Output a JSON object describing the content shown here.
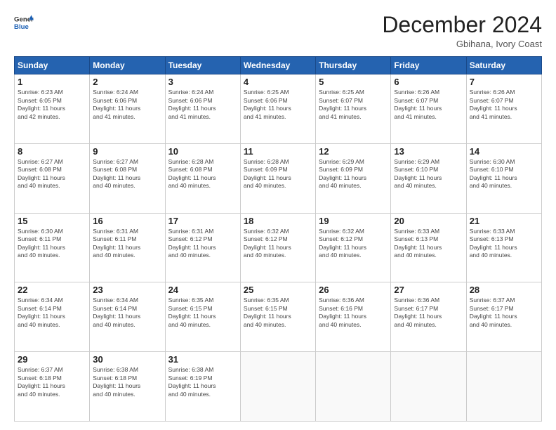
{
  "header": {
    "logo_line1": "General",
    "logo_line2": "Blue",
    "month_title": "December 2024",
    "location": "Gbihana, Ivory Coast"
  },
  "calendar": {
    "days_of_week": [
      "Sunday",
      "Monday",
      "Tuesday",
      "Wednesday",
      "Thursday",
      "Friday",
      "Saturday"
    ],
    "weeks": [
      [
        {
          "day": "1",
          "info": "Sunrise: 6:23 AM\nSunset: 6:05 PM\nDaylight: 11 hours\nand 42 minutes."
        },
        {
          "day": "2",
          "info": "Sunrise: 6:24 AM\nSunset: 6:06 PM\nDaylight: 11 hours\nand 41 minutes."
        },
        {
          "day": "3",
          "info": "Sunrise: 6:24 AM\nSunset: 6:06 PM\nDaylight: 11 hours\nand 41 minutes."
        },
        {
          "day": "4",
          "info": "Sunrise: 6:25 AM\nSunset: 6:06 PM\nDaylight: 11 hours\nand 41 minutes."
        },
        {
          "day": "5",
          "info": "Sunrise: 6:25 AM\nSunset: 6:07 PM\nDaylight: 11 hours\nand 41 minutes."
        },
        {
          "day": "6",
          "info": "Sunrise: 6:26 AM\nSunset: 6:07 PM\nDaylight: 11 hours\nand 41 minutes."
        },
        {
          "day": "7",
          "info": "Sunrise: 6:26 AM\nSunset: 6:07 PM\nDaylight: 11 hours\nand 41 minutes."
        }
      ],
      [
        {
          "day": "8",
          "info": "Sunrise: 6:27 AM\nSunset: 6:08 PM\nDaylight: 11 hours\nand 40 minutes."
        },
        {
          "day": "9",
          "info": "Sunrise: 6:27 AM\nSunset: 6:08 PM\nDaylight: 11 hours\nand 40 minutes."
        },
        {
          "day": "10",
          "info": "Sunrise: 6:28 AM\nSunset: 6:08 PM\nDaylight: 11 hours\nand 40 minutes."
        },
        {
          "day": "11",
          "info": "Sunrise: 6:28 AM\nSunset: 6:09 PM\nDaylight: 11 hours\nand 40 minutes."
        },
        {
          "day": "12",
          "info": "Sunrise: 6:29 AM\nSunset: 6:09 PM\nDaylight: 11 hours\nand 40 minutes."
        },
        {
          "day": "13",
          "info": "Sunrise: 6:29 AM\nSunset: 6:10 PM\nDaylight: 11 hours\nand 40 minutes."
        },
        {
          "day": "14",
          "info": "Sunrise: 6:30 AM\nSunset: 6:10 PM\nDaylight: 11 hours\nand 40 minutes."
        }
      ],
      [
        {
          "day": "15",
          "info": "Sunrise: 6:30 AM\nSunset: 6:11 PM\nDaylight: 11 hours\nand 40 minutes."
        },
        {
          "day": "16",
          "info": "Sunrise: 6:31 AM\nSunset: 6:11 PM\nDaylight: 11 hours\nand 40 minutes."
        },
        {
          "day": "17",
          "info": "Sunrise: 6:31 AM\nSunset: 6:12 PM\nDaylight: 11 hours\nand 40 minutes."
        },
        {
          "day": "18",
          "info": "Sunrise: 6:32 AM\nSunset: 6:12 PM\nDaylight: 11 hours\nand 40 minutes."
        },
        {
          "day": "19",
          "info": "Sunrise: 6:32 AM\nSunset: 6:12 PM\nDaylight: 11 hours\nand 40 minutes."
        },
        {
          "day": "20",
          "info": "Sunrise: 6:33 AM\nSunset: 6:13 PM\nDaylight: 11 hours\nand 40 minutes."
        },
        {
          "day": "21",
          "info": "Sunrise: 6:33 AM\nSunset: 6:13 PM\nDaylight: 11 hours\nand 40 minutes."
        }
      ],
      [
        {
          "day": "22",
          "info": "Sunrise: 6:34 AM\nSunset: 6:14 PM\nDaylight: 11 hours\nand 40 minutes."
        },
        {
          "day": "23",
          "info": "Sunrise: 6:34 AM\nSunset: 6:14 PM\nDaylight: 11 hours\nand 40 minutes."
        },
        {
          "day": "24",
          "info": "Sunrise: 6:35 AM\nSunset: 6:15 PM\nDaylight: 11 hours\nand 40 minutes."
        },
        {
          "day": "25",
          "info": "Sunrise: 6:35 AM\nSunset: 6:15 PM\nDaylight: 11 hours\nand 40 minutes."
        },
        {
          "day": "26",
          "info": "Sunrise: 6:36 AM\nSunset: 6:16 PM\nDaylight: 11 hours\nand 40 minutes."
        },
        {
          "day": "27",
          "info": "Sunrise: 6:36 AM\nSunset: 6:17 PM\nDaylight: 11 hours\nand 40 minutes."
        },
        {
          "day": "28",
          "info": "Sunrise: 6:37 AM\nSunset: 6:17 PM\nDaylight: 11 hours\nand 40 minutes."
        }
      ],
      [
        {
          "day": "29",
          "info": "Sunrise: 6:37 AM\nSunset: 6:18 PM\nDaylight: 11 hours\nand 40 minutes."
        },
        {
          "day": "30",
          "info": "Sunrise: 6:38 AM\nSunset: 6:18 PM\nDaylight: 11 hours\nand 40 minutes."
        },
        {
          "day": "31",
          "info": "Sunrise: 6:38 AM\nSunset: 6:19 PM\nDaylight: 11 hours\nand 40 minutes."
        },
        {
          "day": "",
          "info": ""
        },
        {
          "day": "",
          "info": ""
        },
        {
          "day": "",
          "info": ""
        },
        {
          "day": "",
          "info": ""
        }
      ]
    ]
  }
}
